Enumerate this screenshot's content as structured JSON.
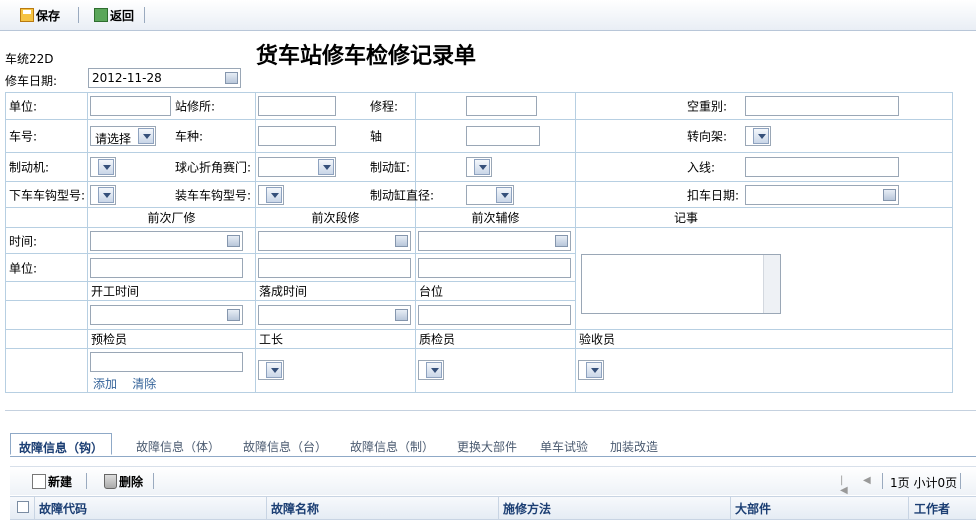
{
  "toolbar": {
    "save_label": "保存",
    "back_label": "返回"
  },
  "form": {
    "title": "货车站修车检修记录单",
    "line_code": "车统22D",
    "repair_date_label": "修车日期:",
    "repair_date_value": "2012-11-28",
    "row1": {
      "unit": "单位:",
      "station": "站修所:",
      "repair_type": "修程:",
      "empty_heavy": "空重别:"
    },
    "row2": {
      "car_no": "车号:",
      "car_no_select": "请选择",
      "car_type": "车种:",
      "axle": "轴",
      "bogie": "转向架:"
    },
    "row3": {
      "brake": "制动机:",
      "ball_valve": "球心折角赛门:",
      "brake_cyl": "制动缸:",
      "line_in": "入线:"
    },
    "row4": {
      "coupler_down": "下车车钩型号:",
      "coupler_up": "装车车钩型号:",
      "brake_cyl_dia": "制动缸直径:",
      "detain_date": "扣车日期:"
    },
    "sections": {
      "factory": "前次厂修",
      "depot": "前次段修",
      "aux": "前次辅修",
      "notes": "记事"
    },
    "time_label": "时间:",
    "unit_label": "单位:",
    "start_time": "开工时间",
    "finish_time": "落成时间",
    "platform": "台位",
    "pre_inspector": "预检员",
    "foreman": "工长",
    "quality_inspector": "质检员",
    "acceptor": "验收员",
    "add_link": "添加",
    "clear_link": "清除"
  },
  "tabs": [
    {
      "label": "故障信息（钩）"
    },
    {
      "label": "故障信息（体）"
    },
    {
      "label": "故障信息（台）"
    },
    {
      "label": "故障信息（制）"
    },
    {
      "label": "更换大部件"
    },
    {
      "label": "单车试验"
    },
    {
      "label": "加装改造"
    }
  ],
  "grid": {
    "new_label": "新建",
    "delete_label": "删除",
    "pager_text": "1页 小计0页",
    "columns": [
      "故障代码",
      "故障名称",
      "施修方法",
      "大部件",
      "工作者"
    ]
  }
}
